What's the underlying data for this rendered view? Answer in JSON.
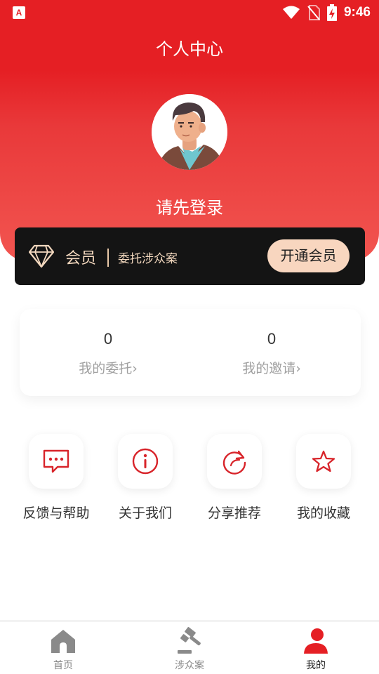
{
  "status_bar": {
    "app_icon_letter": "A",
    "time": "9:46"
  },
  "header": {
    "title": "个人中心"
  },
  "profile": {
    "login_prompt": "请先登录"
  },
  "vip": {
    "title": "会员",
    "description": "委托涉众案",
    "button_label": "开通会员"
  },
  "stats": [
    {
      "value": "0",
      "label": "我的委托›"
    },
    {
      "value": "0",
      "label": "我的邀请›"
    }
  ],
  "menu": [
    {
      "label": "反馈与帮助",
      "icon": "message-dots-icon"
    },
    {
      "label": "关于我们",
      "icon": "info-icon"
    },
    {
      "label": "分享推荐",
      "icon": "share-refresh-icon"
    },
    {
      "label": "我的收藏",
      "icon": "star-icon"
    }
  ],
  "bottom_nav": {
    "tabs": [
      {
        "label": "首页",
        "icon": "home-icon",
        "active": false
      },
      {
        "label": "涉众案",
        "icon": "gavel-icon",
        "active": false
      },
      {
        "label": "我的",
        "icon": "user-icon",
        "active": true
      }
    ]
  },
  "colors": {
    "primary_red": "#e51f24",
    "vip_gold": "#f4d9bf",
    "vip_button": "#f8d6bf",
    "vip_bar_bg": "#141414"
  }
}
